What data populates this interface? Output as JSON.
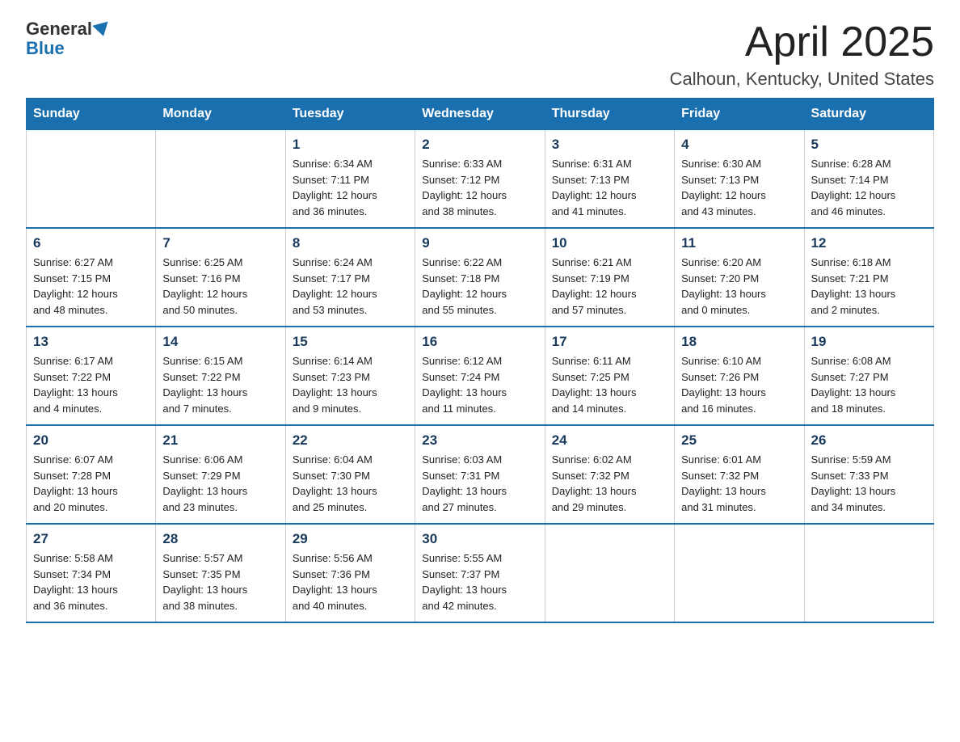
{
  "header": {
    "logo_general": "General",
    "logo_blue": "Blue",
    "title": "April 2025",
    "subtitle": "Calhoun, Kentucky, United States"
  },
  "weekdays": [
    "Sunday",
    "Monday",
    "Tuesday",
    "Wednesday",
    "Thursday",
    "Friday",
    "Saturday"
  ],
  "weeks": [
    [
      {
        "day": "",
        "info": ""
      },
      {
        "day": "",
        "info": ""
      },
      {
        "day": "1",
        "info": "Sunrise: 6:34 AM\nSunset: 7:11 PM\nDaylight: 12 hours\nand 36 minutes."
      },
      {
        "day": "2",
        "info": "Sunrise: 6:33 AM\nSunset: 7:12 PM\nDaylight: 12 hours\nand 38 minutes."
      },
      {
        "day": "3",
        "info": "Sunrise: 6:31 AM\nSunset: 7:13 PM\nDaylight: 12 hours\nand 41 minutes."
      },
      {
        "day": "4",
        "info": "Sunrise: 6:30 AM\nSunset: 7:13 PM\nDaylight: 12 hours\nand 43 minutes."
      },
      {
        "day": "5",
        "info": "Sunrise: 6:28 AM\nSunset: 7:14 PM\nDaylight: 12 hours\nand 46 minutes."
      }
    ],
    [
      {
        "day": "6",
        "info": "Sunrise: 6:27 AM\nSunset: 7:15 PM\nDaylight: 12 hours\nand 48 minutes."
      },
      {
        "day": "7",
        "info": "Sunrise: 6:25 AM\nSunset: 7:16 PM\nDaylight: 12 hours\nand 50 minutes."
      },
      {
        "day": "8",
        "info": "Sunrise: 6:24 AM\nSunset: 7:17 PM\nDaylight: 12 hours\nand 53 minutes."
      },
      {
        "day": "9",
        "info": "Sunrise: 6:22 AM\nSunset: 7:18 PM\nDaylight: 12 hours\nand 55 minutes."
      },
      {
        "day": "10",
        "info": "Sunrise: 6:21 AM\nSunset: 7:19 PM\nDaylight: 12 hours\nand 57 minutes."
      },
      {
        "day": "11",
        "info": "Sunrise: 6:20 AM\nSunset: 7:20 PM\nDaylight: 13 hours\nand 0 minutes."
      },
      {
        "day": "12",
        "info": "Sunrise: 6:18 AM\nSunset: 7:21 PM\nDaylight: 13 hours\nand 2 minutes."
      }
    ],
    [
      {
        "day": "13",
        "info": "Sunrise: 6:17 AM\nSunset: 7:22 PM\nDaylight: 13 hours\nand 4 minutes."
      },
      {
        "day": "14",
        "info": "Sunrise: 6:15 AM\nSunset: 7:22 PM\nDaylight: 13 hours\nand 7 minutes."
      },
      {
        "day": "15",
        "info": "Sunrise: 6:14 AM\nSunset: 7:23 PM\nDaylight: 13 hours\nand 9 minutes."
      },
      {
        "day": "16",
        "info": "Sunrise: 6:12 AM\nSunset: 7:24 PM\nDaylight: 13 hours\nand 11 minutes."
      },
      {
        "day": "17",
        "info": "Sunrise: 6:11 AM\nSunset: 7:25 PM\nDaylight: 13 hours\nand 14 minutes."
      },
      {
        "day": "18",
        "info": "Sunrise: 6:10 AM\nSunset: 7:26 PM\nDaylight: 13 hours\nand 16 minutes."
      },
      {
        "day": "19",
        "info": "Sunrise: 6:08 AM\nSunset: 7:27 PM\nDaylight: 13 hours\nand 18 minutes."
      }
    ],
    [
      {
        "day": "20",
        "info": "Sunrise: 6:07 AM\nSunset: 7:28 PM\nDaylight: 13 hours\nand 20 minutes."
      },
      {
        "day": "21",
        "info": "Sunrise: 6:06 AM\nSunset: 7:29 PM\nDaylight: 13 hours\nand 23 minutes."
      },
      {
        "day": "22",
        "info": "Sunrise: 6:04 AM\nSunset: 7:30 PM\nDaylight: 13 hours\nand 25 minutes."
      },
      {
        "day": "23",
        "info": "Sunrise: 6:03 AM\nSunset: 7:31 PM\nDaylight: 13 hours\nand 27 minutes."
      },
      {
        "day": "24",
        "info": "Sunrise: 6:02 AM\nSunset: 7:32 PM\nDaylight: 13 hours\nand 29 minutes."
      },
      {
        "day": "25",
        "info": "Sunrise: 6:01 AM\nSunset: 7:32 PM\nDaylight: 13 hours\nand 31 minutes."
      },
      {
        "day": "26",
        "info": "Sunrise: 5:59 AM\nSunset: 7:33 PM\nDaylight: 13 hours\nand 34 minutes."
      }
    ],
    [
      {
        "day": "27",
        "info": "Sunrise: 5:58 AM\nSunset: 7:34 PM\nDaylight: 13 hours\nand 36 minutes."
      },
      {
        "day": "28",
        "info": "Sunrise: 5:57 AM\nSunset: 7:35 PM\nDaylight: 13 hours\nand 38 minutes."
      },
      {
        "day": "29",
        "info": "Sunrise: 5:56 AM\nSunset: 7:36 PM\nDaylight: 13 hours\nand 40 minutes."
      },
      {
        "day": "30",
        "info": "Sunrise: 5:55 AM\nSunset: 7:37 PM\nDaylight: 13 hours\nand 42 minutes."
      },
      {
        "day": "",
        "info": ""
      },
      {
        "day": "",
        "info": ""
      },
      {
        "day": "",
        "info": ""
      }
    ]
  ]
}
